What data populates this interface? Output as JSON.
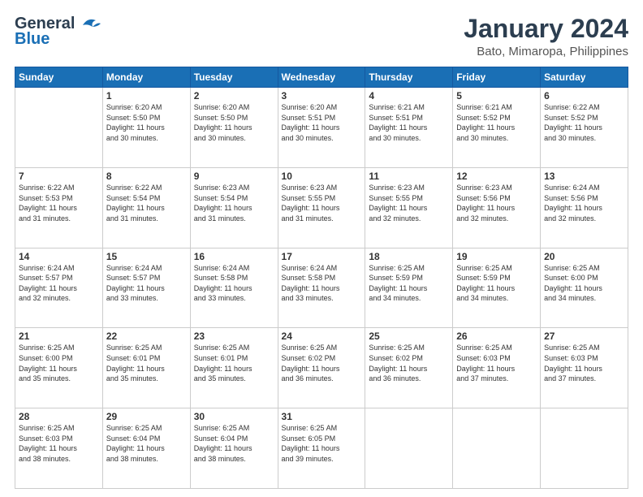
{
  "logo": {
    "line1": "General",
    "line2": "Blue"
  },
  "title": "January 2024",
  "subtitle": "Bato, Mimaropa, Philippines",
  "days_header": [
    "Sunday",
    "Monday",
    "Tuesday",
    "Wednesday",
    "Thursday",
    "Friday",
    "Saturday"
  ],
  "weeks": [
    [
      {
        "day": "",
        "info": ""
      },
      {
        "day": "1",
        "info": "Sunrise: 6:20 AM\nSunset: 5:50 PM\nDaylight: 11 hours\nand 30 minutes."
      },
      {
        "day": "2",
        "info": "Sunrise: 6:20 AM\nSunset: 5:50 PM\nDaylight: 11 hours\nand 30 minutes."
      },
      {
        "day": "3",
        "info": "Sunrise: 6:20 AM\nSunset: 5:51 PM\nDaylight: 11 hours\nand 30 minutes."
      },
      {
        "day": "4",
        "info": "Sunrise: 6:21 AM\nSunset: 5:51 PM\nDaylight: 11 hours\nand 30 minutes."
      },
      {
        "day": "5",
        "info": "Sunrise: 6:21 AM\nSunset: 5:52 PM\nDaylight: 11 hours\nand 30 minutes."
      },
      {
        "day": "6",
        "info": "Sunrise: 6:22 AM\nSunset: 5:52 PM\nDaylight: 11 hours\nand 30 minutes."
      }
    ],
    [
      {
        "day": "7",
        "info": "Sunrise: 6:22 AM\nSunset: 5:53 PM\nDaylight: 11 hours\nand 31 minutes."
      },
      {
        "day": "8",
        "info": "Sunrise: 6:22 AM\nSunset: 5:54 PM\nDaylight: 11 hours\nand 31 minutes."
      },
      {
        "day": "9",
        "info": "Sunrise: 6:23 AM\nSunset: 5:54 PM\nDaylight: 11 hours\nand 31 minutes."
      },
      {
        "day": "10",
        "info": "Sunrise: 6:23 AM\nSunset: 5:55 PM\nDaylight: 11 hours\nand 31 minutes."
      },
      {
        "day": "11",
        "info": "Sunrise: 6:23 AM\nSunset: 5:55 PM\nDaylight: 11 hours\nand 32 minutes."
      },
      {
        "day": "12",
        "info": "Sunrise: 6:23 AM\nSunset: 5:56 PM\nDaylight: 11 hours\nand 32 minutes."
      },
      {
        "day": "13",
        "info": "Sunrise: 6:24 AM\nSunset: 5:56 PM\nDaylight: 11 hours\nand 32 minutes."
      }
    ],
    [
      {
        "day": "14",
        "info": "Sunrise: 6:24 AM\nSunset: 5:57 PM\nDaylight: 11 hours\nand 32 minutes."
      },
      {
        "day": "15",
        "info": "Sunrise: 6:24 AM\nSunset: 5:57 PM\nDaylight: 11 hours\nand 33 minutes."
      },
      {
        "day": "16",
        "info": "Sunrise: 6:24 AM\nSunset: 5:58 PM\nDaylight: 11 hours\nand 33 minutes."
      },
      {
        "day": "17",
        "info": "Sunrise: 6:24 AM\nSunset: 5:58 PM\nDaylight: 11 hours\nand 33 minutes."
      },
      {
        "day": "18",
        "info": "Sunrise: 6:25 AM\nSunset: 5:59 PM\nDaylight: 11 hours\nand 34 minutes."
      },
      {
        "day": "19",
        "info": "Sunrise: 6:25 AM\nSunset: 5:59 PM\nDaylight: 11 hours\nand 34 minutes."
      },
      {
        "day": "20",
        "info": "Sunrise: 6:25 AM\nSunset: 6:00 PM\nDaylight: 11 hours\nand 34 minutes."
      }
    ],
    [
      {
        "day": "21",
        "info": "Sunrise: 6:25 AM\nSunset: 6:00 PM\nDaylight: 11 hours\nand 35 minutes."
      },
      {
        "day": "22",
        "info": "Sunrise: 6:25 AM\nSunset: 6:01 PM\nDaylight: 11 hours\nand 35 minutes."
      },
      {
        "day": "23",
        "info": "Sunrise: 6:25 AM\nSunset: 6:01 PM\nDaylight: 11 hours\nand 35 minutes."
      },
      {
        "day": "24",
        "info": "Sunrise: 6:25 AM\nSunset: 6:02 PM\nDaylight: 11 hours\nand 36 minutes."
      },
      {
        "day": "25",
        "info": "Sunrise: 6:25 AM\nSunset: 6:02 PM\nDaylight: 11 hours\nand 36 minutes."
      },
      {
        "day": "26",
        "info": "Sunrise: 6:25 AM\nSunset: 6:03 PM\nDaylight: 11 hours\nand 37 minutes."
      },
      {
        "day": "27",
        "info": "Sunrise: 6:25 AM\nSunset: 6:03 PM\nDaylight: 11 hours\nand 37 minutes."
      }
    ],
    [
      {
        "day": "28",
        "info": "Sunrise: 6:25 AM\nSunset: 6:03 PM\nDaylight: 11 hours\nand 38 minutes."
      },
      {
        "day": "29",
        "info": "Sunrise: 6:25 AM\nSunset: 6:04 PM\nDaylight: 11 hours\nand 38 minutes."
      },
      {
        "day": "30",
        "info": "Sunrise: 6:25 AM\nSunset: 6:04 PM\nDaylight: 11 hours\nand 38 minutes."
      },
      {
        "day": "31",
        "info": "Sunrise: 6:25 AM\nSunset: 6:05 PM\nDaylight: 11 hours\nand 39 minutes."
      },
      {
        "day": "",
        "info": ""
      },
      {
        "day": "",
        "info": ""
      },
      {
        "day": "",
        "info": ""
      }
    ]
  ]
}
